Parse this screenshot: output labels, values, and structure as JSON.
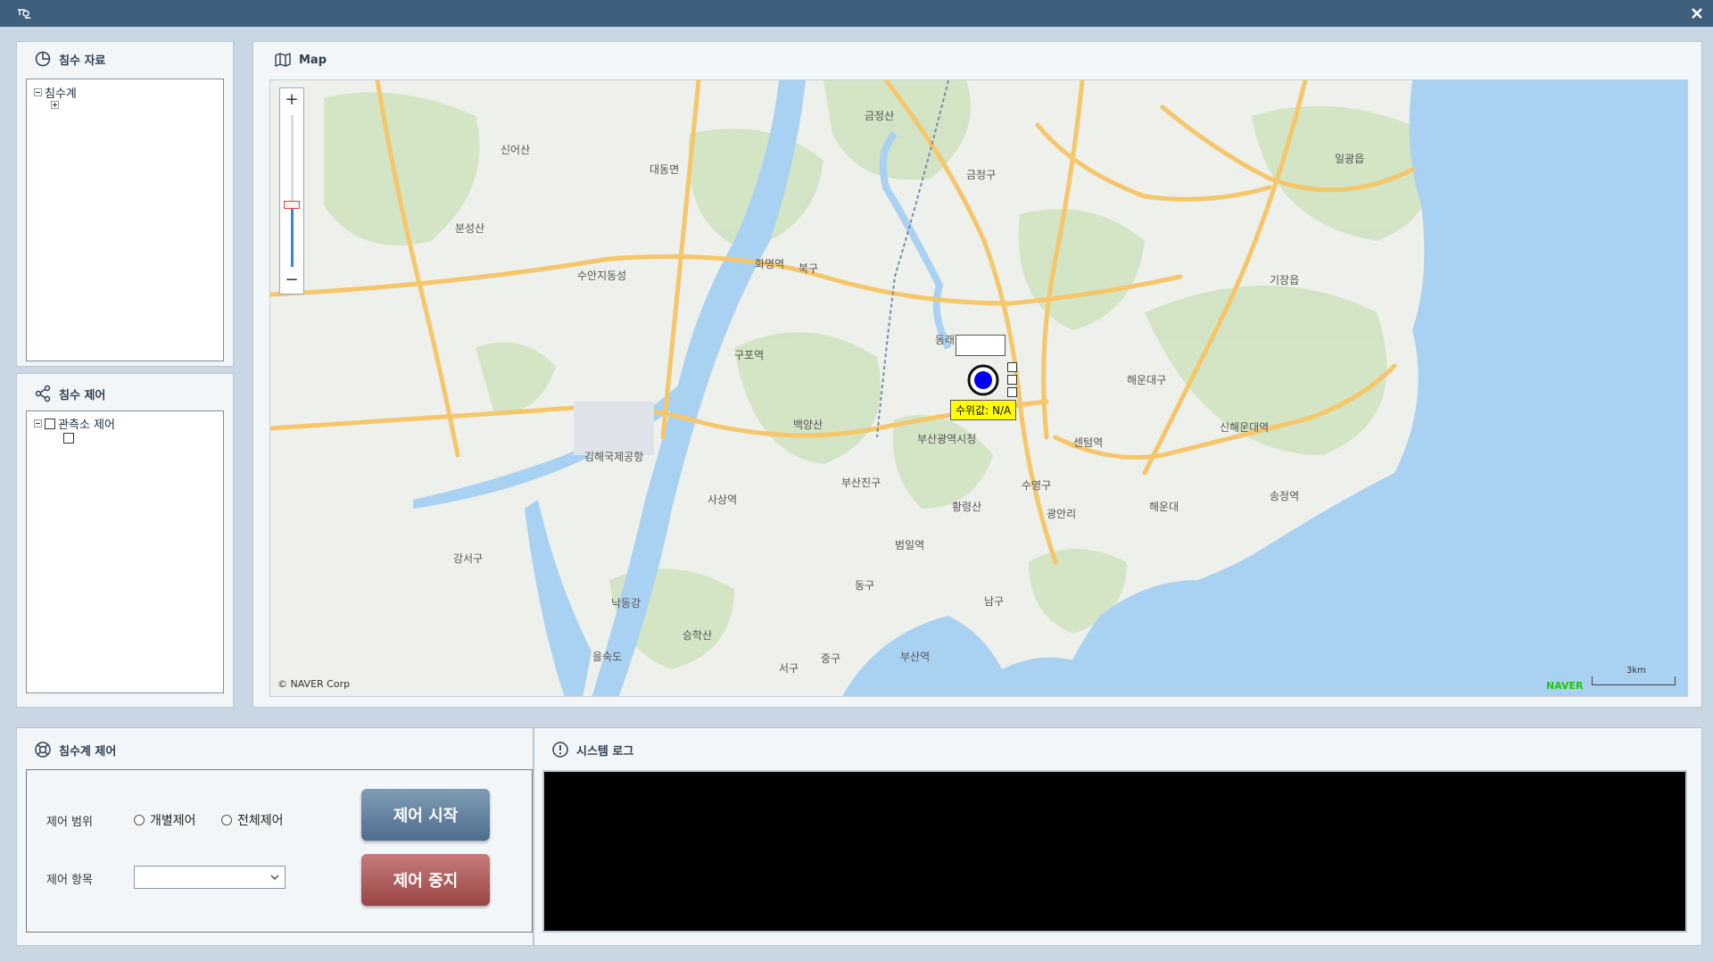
{
  "window": {
    "app_icon": "app-glyph-icon",
    "close_icon": "close-icon"
  },
  "data_panel": {
    "title": "침수 자료",
    "tree": [
      {
        "label": "침수계",
        "expanded": true
      },
      {
        "label": "",
        "expanded": false
      }
    ]
  },
  "control_panel": {
    "title": "침수 제어",
    "tree": [
      {
        "label": "관측소 제어",
        "checked": false
      },
      {
        "label": "",
        "checked": false
      }
    ]
  },
  "map_panel": {
    "title": "Map",
    "copyright": "© NAVER Corp",
    "brand": "NAVER",
    "scale_label": "3km",
    "marker_tooltip": "수위값: N/A",
    "zoom_in": "+",
    "zoom_out": "−",
    "zoom_level": 0.37,
    "places": [
      "대동면",
      "금정구",
      "북구",
      "기장읍",
      "해운대구",
      "동래",
      "부산진구",
      "수영구",
      "남구",
      "강서구",
      "서구",
      "중구",
      "동구",
      "사상역",
      "낙동강",
      "을숙도",
      "김해국제공항",
      "백양산\n(641.3m)",
      "황령산\n(427m)",
      "금정산\n(801.5m)",
      "신어산\n(630.7m)",
      "분성산\n(326.8m)",
      "승학산\n(497m)",
      "일광읍",
      "수안지동성",
      "부산광역시청",
      "센텀역",
      "광안리\n해수욕장",
      "해운대\n해수욕장",
      "신해운대역",
      "구포역",
      "화명역",
      "범일역",
      "부산역",
      "송정역"
    ]
  },
  "gauge_control": {
    "title": "침수계 제어",
    "range_label": "제어 범위",
    "radio_individual": "개별제어",
    "radio_all": "전체제어",
    "item_label": "제어 항목",
    "item_value": "",
    "start_button": "제어 시작",
    "stop_button": "제어 중지"
  },
  "system_log": {
    "title": "시스템 로그",
    "lines": []
  },
  "colors": {
    "titlebar": "#3f5f7e",
    "sea": "#a9d1f1",
    "land": "#eef0eb",
    "forest": "#cfe3c1",
    "river": "#a9d1f1",
    "highway": "#f5c66a",
    "tooltip": "#ffff00",
    "marker": "#0000ee"
  }
}
